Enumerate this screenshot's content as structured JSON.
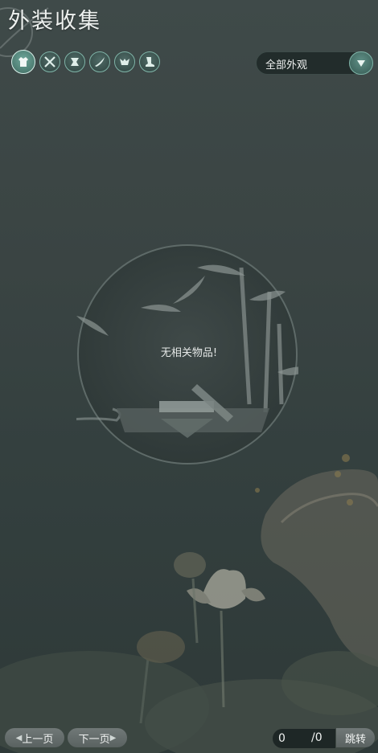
{
  "header": {
    "title": "外装收集"
  },
  "categories": [
    {
      "icon": "outfit-icon",
      "active": true
    },
    {
      "icon": "weapon-icon",
      "active": false
    },
    {
      "icon": "hairpiece-icon",
      "active": false
    },
    {
      "icon": "wing-icon",
      "active": false
    },
    {
      "icon": "mount-icon",
      "active": false
    },
    {
      "icon": "boots-icon",
      "active": false
    }
  ],
  "filter": {
    "selected": "全部外观"
  },
  "empty_state": {
    "message": "无相关物品!"
  },
  "pager": {
    "prev_label": "上一页",
    "next_label": "下一页",
    "current_page": "0",
    "total_pages": "/0",
    "jump_label": "跳转"
  },
  "colors": {
    "accent": "#7fb3a7",
    "background": "#3a4443"
  }
}
